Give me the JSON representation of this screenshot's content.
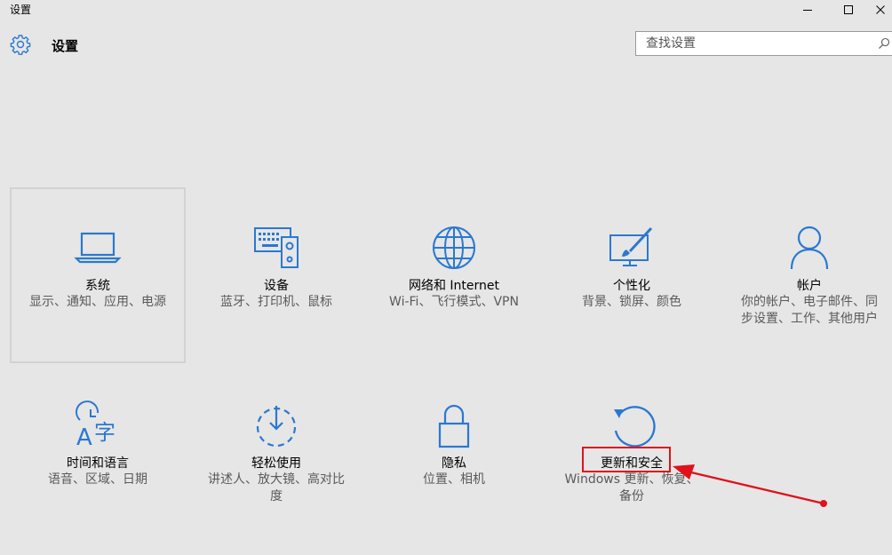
{
  "window": {
    "title": "设置",
    "controls": [
      "minimize",
      "maximize",
      "close"
    ]
  },
  "header": {
    "title": "设置",
    "search_placeholder": "查找设置"
  },
  "colors": {
    "accent": "#2b78d0",
    "background": "#e6e6e6",
    "highlight": "#e0121a"
  },
  "tiles": [
    {
      "name": "系统",
      "desc": "显示、通知、应用、电源",
      "icon": "laptop-icon"
    },
    {
      "name": "设备",
      "desc": "蓝牙、打印机、鼠标",
      "icon": "devices-icon"
    },
    {
      "name": "网络和 Internet",
      "desc": "Wi-Fi、飞行模式、VPN",
      "icon": "globe-icon"
    },
    {
      "name": "个性化",
      "desc": "背景、锁屏、颜色",
      "icon": "personalization-icon"
    },
    {
      "name": "帐户",
      "desc": "你的帐户、电子邮件、同步设置、工作、其他用户",
      "icon": "person-icon"
    },
    {
      "name": "时间和语言",
      "desc": "语音、区域、日期",
      "icon": "time-language-icon"
    },
    {
      "name": "轻松使用",
      "desc": "讲述人、放大镜、高对比度",
      "icon": "ease-of-access-icon"
    },
    {
      "name": "隐私",
      "desc": "位置、相机",
      "icon": "lock-icon"
    },
    {
      "name": "更新和安全",
      "desc": "Windows 更新、恢复、备份",
      "icon": "update-icon"
    }
  ]
}
